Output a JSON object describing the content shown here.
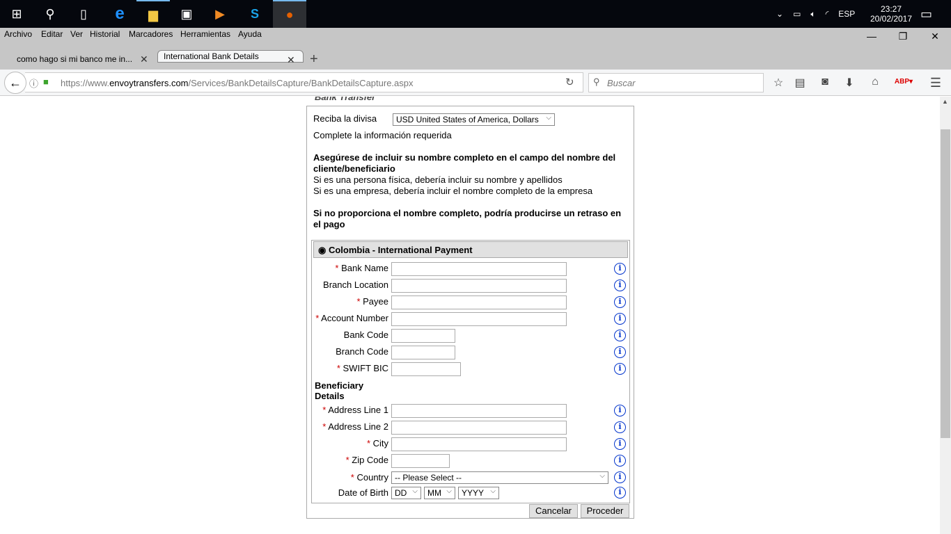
{
  "taskbar": {
    "apps": [
      "windows-start",
      "search",
      "task-view",
      "edge",
      "file-explorer",
      "store",
      "media-player",
      "skype",
      "firefox"
    ],
    "tray": {
      "language": "ESP",
      "time": "23:27",
      "date": "20/02/2017"
    }
  },
  "menubar": [
    "Archivo",
    "Editar",
    "Ver",
    "Historial",
    "Marcadores",
    "Herramientas",
    "Ayuda"
  ],
  "tabs": [
    {
      "label": "como hago si mi banco me in...",
      "selected": false
    },
    {
      "label": "International Bank Details",
      "selected": true
    }
  ],
  "url": {
    "prefix": "https://www.",
    "domain": "envoytransfers.com",
    "path": "/Services/BankDetailsCapture/BankDetailsCapture.aspx"
  },
  "search_placeholder": "Buscar",
  "page": {
    "section_title": "Bank Transfer",
    "currency_label": "Reciba la divisa",
    "currency_value": "USD United States of America, Dollars",
    "complete_info": "Complete la información requerida",
    "warning_bold": "Asegúrese de incluir su nombre completo en el campo del nombre del cliente/beneficiario",
    "warning_line1": "Si es una persona física, debería incluir su nombre y apellidos",
    "warning_line2": "Si es una empresa, debería incluir el nombre completo de la empresa",
    "delay_warning": "Si no proporciona el nombre completo, podría producirse un retraso en el pago",
    "payment_option": "Colombia - International Payment",
    "bank_fields": [
      {
        "label": "Bank Name",
        "required": true,
        "value": ""
      },
      {
        "label": "Branch Location",
        "required": false,
        "value": ""
      },
      {
        "label": "Payee",
        "required": true,
        "value": ""
      },
      {
        "label": "Account Number",
        "required": true,
        "value": ""
      },
      {
        "label": "Bank Code",
        "required": false,
        "value": ""
      },
      {
        "label": "Branch Code",
        "required": false,
        "value": ""
      },
      {
        "label": "SWIFT BIC",
        "required": true,
        "value": ""
      }
    ],
    "beneficiary_heading": "Beneficiary Details",
    "beneficiary_fields": [
      {
        "label": "Address Line 1",
        "required": true,
        "value": ""
      },
      {
        "label": "Address Line 2",
        "required": true,
        "value": ""
      },
      {
        "label": "City",
        "required": true,
        "value": ""
      },
      {
        "label": "Zip Code",
        "required": true,
        "value": ""
      }
    ],
    "country_label": "Country",
    "country_value": "-- Please Select --",
    "dob_label": "Date of Birth",
    "dob": {
      "day": "DD",
      "month": "MM",
      "year": "YYYY"
    },
    "cancel": "Cancelar",
    "proceed": "Proceder"
  }
}
